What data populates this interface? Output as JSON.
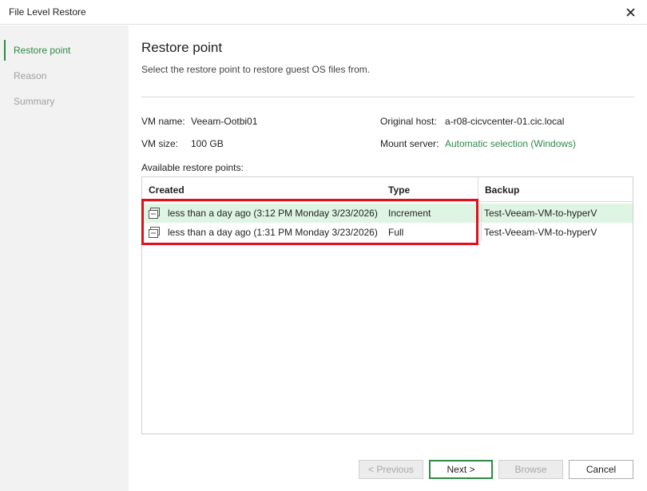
{
  "window": {
    "title": "File Level Restore",
    "close_icon": "close-icon"
  },
  "sidebar": {
    "items": [
      {
        "label": "Restore point",
        "active": true
      },
      {
        "label": "Reason",
        "active": false
      },
      {
        "label": "Summary",
        "active": false
      }
    ]
  },
  "page": {
    "heading": "Restore point",
    "subtitle": "Select the restore point to restore guest OS files from."
  },
  "vm_info": {
    "name_label": "VM name:",
    "name_value": "Veeam-Ootbi01",
    "size_label": "VM size:",
    "size_value": "100 GB",
    "host_label": "Original host:",
    "host_value": "a-r08-cicvcenter-01.cic.local",
    "mount_label": "Mount server:",
    "mount_value": "Automatic selection (Windows)"
  },
  "restore_points": {
    "label": "Available restore points:",
    "columns": [
      "Created",
      "Type",
      "Backup"
    ],
    "rows": [
      {
        "created": "less than a day ago (3:12 PM Monday 3/23/2026)",
        "type": "Increment",
        "backup": "Test-Veeam-VM-to-hyperV",
        "selected": true,
        "icon": "restore-point-icon"
      },
      {
        "created": "less than a day ago (1:31 PM Monday 3/23/2026)",
        "type": "Full",
        "backup": "Test-Veeam-VM-to-hyperV",
        "selected": false,
        "icon": "restore-point-icon"
      }
    ]
  },
  "buttons": {
    "previous": "< Previous",
    "next": "Next >",
    "browse": "Browse",
    "cancel": "Cancel"
  },
  "colors": {
    "accent": "#2f8a45",
    "selection": "#dff5e3",
    "highlight": "#e0101c"
  }
}
